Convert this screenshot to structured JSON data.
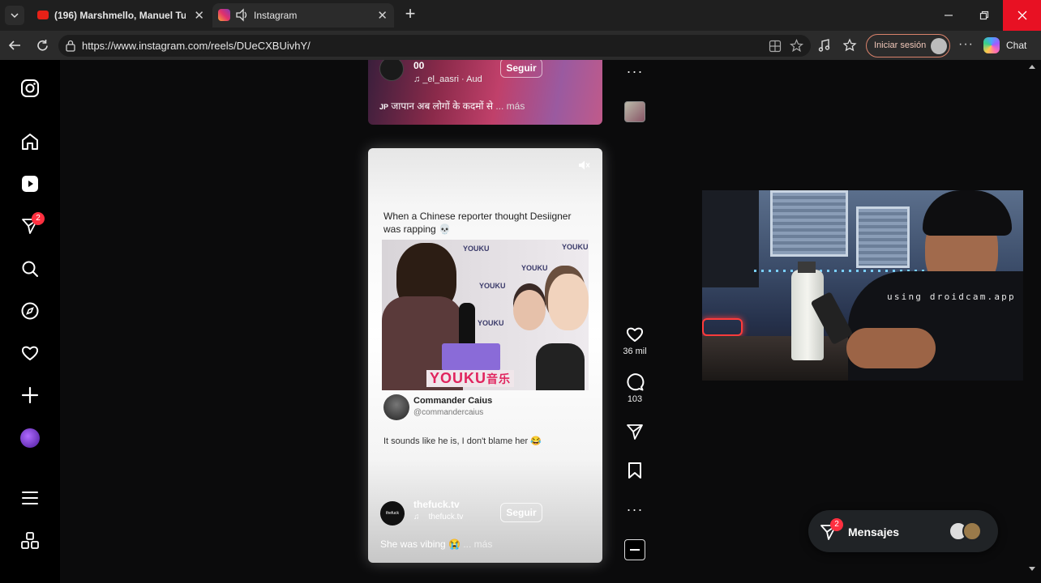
{
  "tabs": [
    {
      "title": "(196) Marshmello, Manuel Turizo -",
      "active": false
    },
    {
      "title": "Instagram",
      "active": true
    }
  ],
  "address": {
    "url": "https://www.instagram.com/reels/DUeCXBUivhY/"
  },
  "toolbar": {
    "sign_in": "Iniciar sesión",
    "chat": "Chat"
  },
  "sidebar": {
    "notifications_badge": "2"
  },
  "top_reel": {
    "username": "00",
    "follow": "Seguir",
    "audio": "_el_aasri · Aud",
    "caption": "जापान अब लोगों के कदमों से",
    "more": "... más",
    "caption_prefix": "JP"
  },
  "main_reel": {
    "headline": "When a Chinese reporter thought Desiigner was rapping 💀",
    "tweet_name": "Commander Caius",
    "tweet_handle": "@commandercaius",
    "tweet_text": "It sounds like he is, I don't blame her 😂",
    "photo_brand": "YOUKU",
    "photo_brand_cn": "音乐",
    "poster_username": "thefuck.tv",
    "poster_audio": "thefuck.tv",
    "follow": "Seguir",
    "caption": "She was vibing 😭",
    "more": "... más",
    "avatar_text": "thefuck"
  },
  "actions": {
    "likes": "36 mil",
    "comments": "103"
  },
  "cam": {
    "watermark": "using droidcam.app"
  },
  "messages": {
    "label": "Mensajes",
    "badge": "2"
  }
}
